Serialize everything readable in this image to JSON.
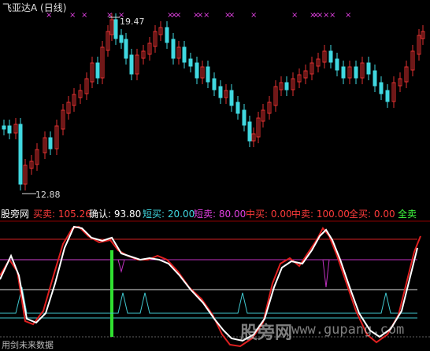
{
  "header": {
    "title": "飞亚达A (日线)"
  },
  "price_chart": {
    "high_label": "19.47",
    "low_label": "12.88",
    "colors": {
      "up": "#e03030",
      "down": "#40d8e0",
      "marker": "#e040e0"
    }
  },
  "indicator": {
    "name": "股旁网",
    "items": [
      {
        "label": "买卖:",
        "value": "105.26",
        "color": "#ff3b3b"
      },
      {
        "label": "确认:",
        "value": "93.80",
        "color": "#ffffff"
      },
      {
        "label": "短买:",
        "value": "20.00",
        "color": "#40d8e0"
      },
      {
        "label": "短卖:",
        "value": "80.00",
        "color": "#e040e0"
      },
      {
        "label": "中买:",
        "value": "0.00",
        "color": "#ff3b3b"
      },
      {
        "label": "中卖:",
        "value": "100.00",
        "color": "#ff3b3b"
      },
      {
        "label": "全买:",
        "value": "0.00",
        "color": "#ff3b3b"
      },
      {
        "label": "全卖",
        "value": "",
        "color": "#40ff40"
      }
    ]
  },
  "watermark": {
    "text": "股旁网",
    "url": "www.gupang.com"
  },
  "footer": {
    "text": "用剑未来数据"
  }
}
